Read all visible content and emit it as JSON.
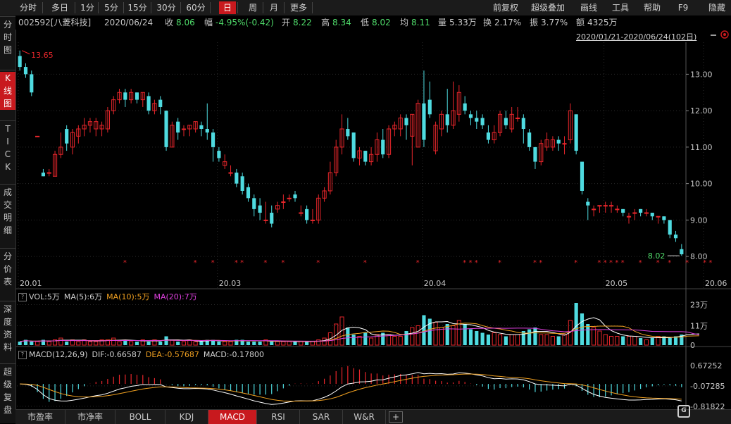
{
  "topbar": {
    "tabs": [
      {
        "label": "分时",
        "active": false
      },
      {
        "label": "多日",
        "active": false
      },
      {
        "label": "1分",
        "active": false
      },
      {
        "label": "5分",
        "active": false
      },
      {
        "label": "15分",
        "active": false
      },
      {
        "label": "30分",
        "active": false
      },
      {
        "label": "60分",
        "active": false
      },
      {
        "label": "日",
        "active": true
      },
      {
        "label": "周",
        "active": false
      },
      {
        "label": "月",
        "active": false
      },
      {
        "label": "更多",
        "active": false
      }
    ],
    "right_tabs": [
      "前复权",
      "超级叠加",
      "画线",
      "工具",
      "帮助",
      "F9",
      "隐藏"
    ]
  },
  "info": {
    "code": "002592[八菱科技]",
    "date": "2020/06/24",
    "close_label": "收",
    "close": "8.06",
    "change_label": "幅",
    "change": "-4.95%(-0.42)",
    "open_label": "开",
    "open": "8.22",
    "high_label": "高",
    "high": "8.34",
    "low_label": "低",
    "low": "8.02",
    "avg_label": "均",
    "avg": "8.11",
    "vol_label": "量",
    "vol": "5.33万",
    "turnover_label": "换",
    "turnover": "2.17%",
    "amp_label": "振",
    "amp": "3.77%",
    "amount_label": "额",
    "amount": "4325万",
    "range": "2020/01/21-2020/06/24(102日)"
  },
  "leftbar": [
    "分时图",
    "K线图",
    "TICK",
    "成交明细",
    "分价表",
    "深度资料",
    "超级复盘"
  ],
  "bottom_tabs": [
    {
      "label": "市盈率",
      "active": false
    },
    {
      "label": "市净率",
      "active": false
    },
    {
      "label": "BOLL",
      "active": false
    },
    {
      "label": "KDJ",
      "active": false
    },
    {
      "label": "MACD",
      "active": true
    },
    {
      "label": "RSI",
      "active": false
    },
    {
      "label": "SAR",
      "active": false
    },
    {
      "label": "W&R",
      "active": false
    }
  ],
  "colors": {
    "up": "#e8262b",
    "down": "#4fdbe0",
    "ma5": "#ffffff",
    "ma10": "#f0a020",
    "ma20": "#e040e0",
    "bg": "#000000",
    "grid": "#2a2a2a"
  },
  "chart_data": [
    {
      "type": "candlestick",
      "name": "K线",
      "ylim": [
        7.5,
        13.8
      ],
      "yticks": [
        "13.00",
        "12.00",
        "11.00",
        "10.00",
        "9.00",
        "8.00"
      ],
      "xticks": [
        "20.01",
        "20.03",
        "20.04",
        "20.05",
        "20.06"
      ],
      "max_label": "13.65",
      "min_label": "8.02",
      "candles": [
        [
          13.5,
          13.2,
          13.65,
          13.1
        ],
        [
          13.2,
          13.0,
          13.3,
          12.9
        ],
        [
          13.0,
          12.5,
          13.1,
          12.4
        ],
        [
          11.3,
          11.3,
          11.3,
          11.3
        ],
        [
          10.3,
          10.2,
          10.4,
          10.2
        ],
        [
          10.3,
          10.3,
          10.4,
          10.2
        ],
        [
          10.2,
          10.8,
          10.9,
          10.2
        ],
        [
          10.8,
          11.0,
          11.4,
          10.7
        ],
        [
          11.5,
          11.1,
          11.6,
          10.9
        ],
        [
          11.0,
          11.4,
          11.5,
          10.8
        ],
        [
          11.3,
          11.5,
          11.6,
          11.1
        ],
        [
          11.5,
          11.6,
          11.8,
          11.3
        ],
        [
          11.6,
          11.7,
          11.8,
          11.4
        ],
        [
          11.5,
          11.7,
          11.8,
          11.3
        ],
        [
          11.5,
          11.6,
          11.7,
          11.3
        ],
        [
          11.5,
          12.0,
          12.1,
          11.4
        ],
        [
          12.0,
          12.3,
          12.4,
          11.9
        ],
        [
          12.3,
          12.5,
          12.6,
          12.2
        ],
        [
          12.5,
          12.3,
          12.6,
          12.1
        ],
        [
          12.3,
          12.5,
          12.6,
          12.2
        ],
        [
          12.5,
          12.3,
          12.5,
          12.2
        ],
        [
          12.3,
          12.5,
          12.5,
          12.1
        ],
        [
          12.4,
          12.0,
          12.5,
          11.9
        ],
        [
          12.0,
          12.2,
          12.3,
          11.9
        ],
        [
          12.3,
          12.1,
          12.4,
          11.9
        ],
        [
          12.0,
          11.0,
          12.0,
          10.9
        ],
        [
          11.0,
          11.6,
          11.7,
          11.0
        ],
        [
          11.7,
          11.4,
          11.8,
          11.2
        ],
        [
          11.5,
          11.5,
          11.6,
          11.3
        ],
        [
          11.5,
          11.6,
          11.6,
          11.3
        ],
        [
          11.5,
          11.7,
          11.7,
          11.4
        ],
        [
          11.6,
          11.5,
          11.7,
          11.3
        ],
        [
          11.5,
          11.4,
          12.2,
          11.2
        ],
        [
          11.4,
          11.0,
          11.5,
          10.6
        ],
        [
          10.9,
          10.7,
          11.0,
          10.6
        ],
        [
          10.5,
          10.6,
          10.8,
          10.4
        ],
        [
          10.3,
          10.3,
          10.5,
          10.2
        ],
        [
          10.3,
          10.0,
          10.4,
          9.9
        ],
        [
          10.2,
          9.8,
          10.3,
          9.7
        ],
        [
          9.9,
          9.6,
          10.0,
          9.5
        ],
        [
          9.6,
          9.3,
          9.7,
          9.1
        ],
        [
          9.4,
          9.2,
          9.6,
          9.0
        ],
        [
          9.0,
          9.0,
          9.5,
          8.9
        ],
        [
          9.2,
          8.9,
          9.4,
          8.8
        ],
        [
          9.3,
          9.4,
          9.5,
          9.2
        ],
        [
          9.5,
          9.5,
          9.7,
          9.3
        ],
        [
          9.6,
          9.6,
          9.7,
          9.5
        ],
        [
          9.7,
          9.6,
          9.8,
          9.5
        ],
        [
          9.2,
          9.2,
          9.4,
          9.1
        ],
        [
          9.3,
          9.0,
          9.4,
          8.9
        ],
        [
          9.0,
          9.0,
          9.3,
          8.9
        ],
        [
          9.0,
          9.6,
          9.7,
          8.9
        ],
        [
          9.6,
          9.8,
          9.9,
          9.5
        ],
        [
          9.8,
          10.3,
          10.6,
          9.7
        ],
        [
          10.3,
          11.0,
          11.2,
          10.2
        ],
        [
          11.0,
          11.5,
          11.9,
          10.8
        ],
        [
          11.5,
          11.3,
          11.8,
          11.2
        ],
        [
          11.4,
          10.7,
          11.4,
          10.6
        ],
        [
          10.7,
          10.9,
          11.0,
          10.5
        ],
        [
          10.9,
          10.6,
          10.9,
          10.5
        ],
        [
          10.6,
          10.8,
          11.0,
          10.5
        ],
        [
          10.8,
          11.2,
          11.4,
          10.6
        ],
        [
          11.2,
          10.8,
          11.5,
          10.7
        ],
        [
          10.8,
          11.5,
          11.6,
          10.7
        ],
        [
          11.5,
          11.6,
          11.7,
          11.3
        ],
        [
          11.5,
          11.8,
          11.9,
          11.3
        ],
        [
          11.8,
          11.6,
          11.9,
          11.2
        ],
        [
          11.3,
          11.9,
          11.9,
          10.5
        ],
        [
          11.0,
          12.2,
          12.3,
          11.0
        ],
        [
          12.2,
          11.2,
          13.1,
          11.0
        ],
        [
          12.3,
          11.9,
          12.8,
          11.8
        ],
        [
          10.9,
          11.6,
          11.7,
          10.8
        ],
        [
          11.5,
          11.9,
          12.0,
          11.3
        ],
        [
          11.9,
          11.6,
          12.6,
          11.4
        ],
        [
          11.6,
          12.0,
          12.8,
          11.5
        ],
        [
          11.9,
          12.5,
          12.7,
          11.7
        ],
        [
          12.2,
          12.0,
          12.4,
          11.9
        ],
        [
          11.9,
          11.8,
          12.0,
          11.6
        ],
        [
          11.8,
          11.7,
          12.0,
          11.5
        ],
        [
          11.8,
          11.6,
          11.9,
          11.5
        ],
        [
          11.4,
          11.2,
          11.6,
          11.1
        ],
        [
          11.2,
          11.4,
          11.6,
          11.1
        ],
        [
          11.4,
          11.9,
          12.0,
          11.3
        ],
        [
          11.8,
          11.6,
          12.0,
          11.5
        ],
        [
          11.5,
          11.9,
          12.1,
          11.4
        ],
        [
          11.8,
          11.8,
          12.1,
          11.7
        ],
        [
          11.8,
          11.5,
          11.9,
          11.1
        ],
        [
          11.4,
          11.0,
          11.5,
          10.9
        ],
        [
          11.0,
          10.6,
          11.0,
          10.4
        ],
        [
          10.6,
          11.1,
          11.2,
          10.5
        ],
        [
          11.0,
          11.2,
          11.4,
          10.9
        ],
        [
          11.0,
          11.2,
          11.3,
          10.9
        ],
        [
          11.2,
          11.1,
          11.3,
          10.9
        ],
        [
          11.1,
          11.1,
          11.3,
          10.8
        ],
        [
          11.2,
          12.0,
          12.2,
          11.1
        ],
        [
          11.9,
          10.9,
          11.9,
          10.8
        ],
        [
          10.6,
          9.8,
          10.6,
          9.7
        ],
        [
          9.5,
          9.4,
          9.6,
          9.0
        ],
        [
          9.3,
          9.3,
          9.4,
          9.1
        ],
        [
          9.4,
          9.4,
          9.4,
          9.2
        ],
        [
          9.4,
          9.4,
          9.5,
          9.2
        ],
        [
          9.4,
          9.4,
          9.5,
          9.2
        ],
        [
          9.3,
          9.3,
          9.4,
          9.2
        ],
        [
          9.3,
          9.2,
          9.3,
          9.1
        ],
        [
          9.1,
          9.1,
          9.2,
          8.9
        ],
        [
          9.2,
          9.2,
          9.3,
          9.0
        ],
        [
          9.3,
          9.2,
          9.3,
          9.1
        ],
        [
          9.2,
          9.2,
          9.3,
          9.1
        ],
        [
          9.2,
          9.1,
          9.2,
          9.0
        ],
        [
          9.1,
          9.1,
          9.1,
          8.9
        ],
        [
          9.1,
          9.0,
          9.1,
          8.9
        ],
        [
          9.0,
          8.6,
          9.0,
          8.5
        ],
        [
          8.6,
          8.5,
          8.7,
          8.4
        ],
        [
          8.2,
          8.06,
          8.34,
          8.02
        ]
      ],
      "star_indices": [
        18,
        30,
        33,
        37,
        38,
        42,
        45,
        51,
        59,
        68,
        76,
        77,
        78,
        82,
        88,
        89,
        95,
        99,
        100,
        101,
        102,
        103,
        106,
        109,
        111,
        114,
        117,
        118
      ]
    },
    {
      "type": "bar",
      "name": "VOL",
      "legend": [
        {
          "label": "VOL:5万",
          "color": "#d0d0d0"
        },
        {
          "label": "MA(5):6万",
          "color": "#d0d0d0"
        },
        {
          "label": "MA(10):5万",
          "color": "#f0a020"
        },
        {
          "label": "MA(20):7万",
          "color": "#e040e0"
        }
      ],
      "yticks": [
        "23万",
        "11万",
        "0"
      ],
      "ylim": [
        0,
        24
      ],
      "values": [
        2,
        3,
        2,
        2,
        3,
        2,
        3,
        4,
        2,
        3,
        2,
        3,
        2,
        2,
        3,
        3,
        4,
        2,
        3,
        2,
        2,
        3,
        2,
        3,
        2,
        5,
        3,
        2,
        2,
        3,
        2,
        2,
        3,
        3,
        2,
        2,
        2,
        3,
        3,
        2,
        2,
        2,
        3,
        2,
        2,
        2,
        2,
        2,
        2,
        2,
        2,
        3,
        4,
        7,
        12,
        16,
        10,
        6,
        5,
        7,
        4,
        6,
        7,
        6,
        5,
        5,
        8,
        10,
        11,
        17,
        15,
        13,
        10,
        12,
        11,
        14,
        12,
        9,
        8,
        7,
        6,
        7,
        6,
        5,
        6,
        6,
        8,
        9,
        10,
        6,
        6,
        5,
        5,
        6,
        14,
        24,
        18,
        12,
        10,
        8,
        6,
        5,
        5,
        5,
        5,
        5,
        4,
        3,
        4,
        5,
        5,
        4,
        5,
        6,
        10,
        6,
        5
      ]
    },
    {
      "type": "bar",
      "name": "MACD",
      "legend": [
        {
          "label": "MACD(12,26,9)",
          "color": "#d0d0d0"
        },
        {
          "label": "DIF:-0.66587",
          "color": "#d0d0d0"
        },
        {
          "label": "DEA:-0.57687",
          "color": "#f0a020"
        },
        {
          "label": "MACD:-0.17800",
          "color": "#d0d0d0"
        }
      ],
      "yticks": [
        "0.67252",
        "-0.07285",
        "-0.81822"
      ],
      "ylim": [
        -0.85,
        0.7
      ]
    }
  ]
}
